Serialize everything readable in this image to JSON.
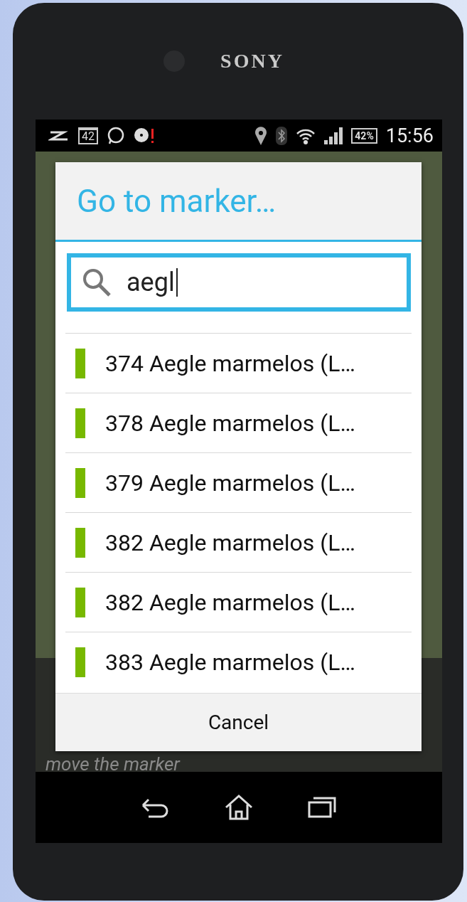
{
  "device": {
    "brand": "SONY"
  },
  "status_bar": {
    "calendar_day": "42",
    "battery": "42%",
    "time": "15:56"
  },
  "background": {
    "hint": "move the marker"
  },
  "dialog": {
    "title": "Go to marker…",
    "search": {
      "value": "aegl"
    },
    "results": [
      {
        "label": "374 Aegle marmelos (L…"
      },
      {
        "label": "378 Aegle marmelos (L…"
      },
      {
        "label": "379 Aegle marmelos (L…"
      },
      {
        "label": "382 Aegle marmelos (L…"
      },
      {
        "label": "382 Aegle marmelos (L…"
      },
      {
        "label": "383 Aegle marmelos (L…"
      }
    ],
    "cancel": "Cancel"
  }
}
